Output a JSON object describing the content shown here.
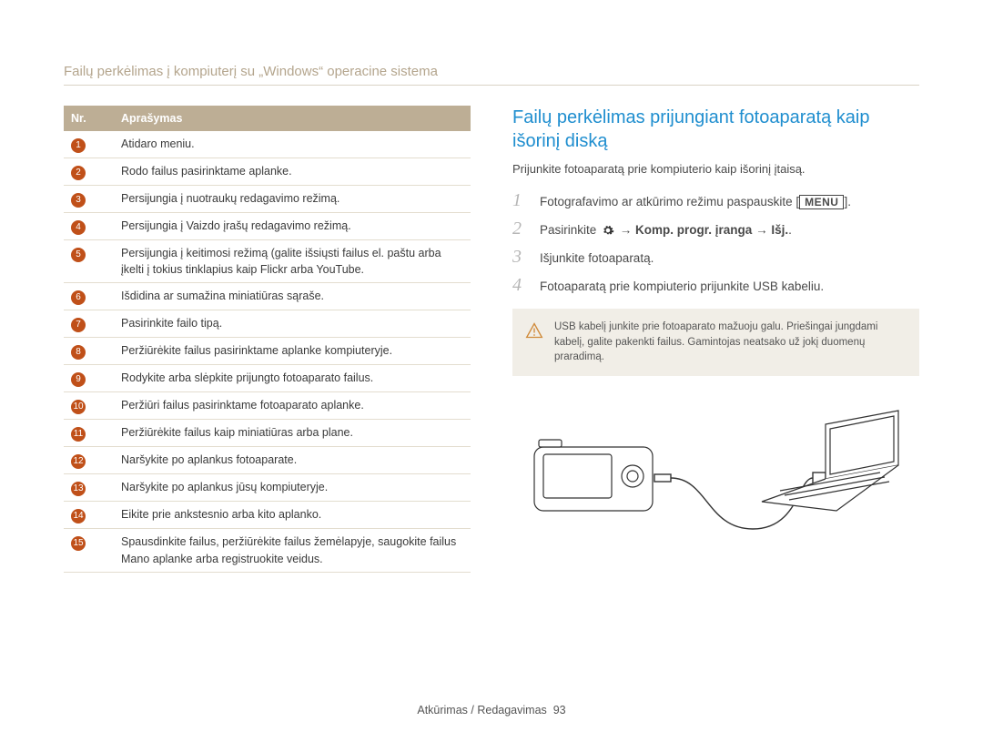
{
  "header": "Failų perkėlimas į kompiuterį su „Windows“ operacine sistema",
  "table": {
    "head_nr": "Nr.",
    "head_desc": "Aprašymas",
    "rows": [
      {
        "n": "1",
        "d": "Atidaro meniu."
      },
      {
        "n": "2",
        "d": "Rodo failus pasirinktame aplanke."
      },
      {
        "n": "3",
        "d": "Persijungia į nuotraukų redagavimo režimą."
      },
      {
        "n": "4",
        "d": "Persijungia į Vaizdo įrašų redagavimo režimą."
      },
      {
        "n": "5",
        "d": "Persijungia į keitimosi režimą (galite išsiųsti failus el. paštu arba įkelti į tokius tinklapius kaip Flickr arba YouTube."
      },
      {
        "n": "6",
        "d": "Išdidina ar sumažina miniatiūras sąraše."
      },
      {
        "n": "7",
        "d": "Pasirinkite failo tipą."
      },
      {
        "n": "8",
        "d": "Peržiūrėkite failus pasirinktame aplanke kompiuteryje."
      },
      {
        "n": "9",
        "d": "Rodykite arba slėpkite prijungto fotoaparato failus."
      },
      {
        "n": "10",
        "d": "Peržiūri failus pasirinktame fotoaparato aplanke."
      },
      {
        "n": "11",
        "d": "Peržiūrėkite failus kaip miniatiūras arba plane."
      },
      {
        "n": "12",
        "d": "Naršykite po aplankus fotoaparate."
      },
      {
        "n": "13",
        "d": "Naršykite po aplankus jūsų kompiuteryje."
      },
      {
        "n": "14",
        "d": "Eikite prie ankstesnio arba kito aplanko."
      },
      {
        "n": "15",
        "d": "Spausdinkite failus, peržiūrėkite failus žemėlapyje, saugokite failus Mano aplanke arba registruokite veidus."
      }
    ]
  },
  "right": {
    "title": "Failų perkėlimas prijungiant fotoaparatą kaip išorinį diską",
    "intro": "Prijunkite fotoaparatą prie kompiuterio kaip išorinį įtaisą.",
    "steps": {
      "s1_a": "Fotografavimo ar atkūrimo režimu paspauskite [",
      "s1_menu": "MENU",
      "s1_b": "].",
      "s2_a": "Pasirinkite ",
      "s2_b": " → ",
      "s2_bold": "Komp. progr. įranga",
      "s2_c": " → ",
      "s2_d": "Išj.",
      "s2_e": ".",
      "s3": "Išjunkite fotoaparatą.",
      "s4": "Fotoaparatą prie kompiuterio prijunkite USB kabeliu."
    },
    "note": "USB kabelį junkite prie fotoaparato mažuoju galu. Priešingai jungdami kabelį, galite pakenkti failus. Gamintojas neatsako už jokį duomenų praradimą."
  },
  "footer": {
    "text": "Atkūrimas / Redagavimas",
    "page": "93"
  }
}
